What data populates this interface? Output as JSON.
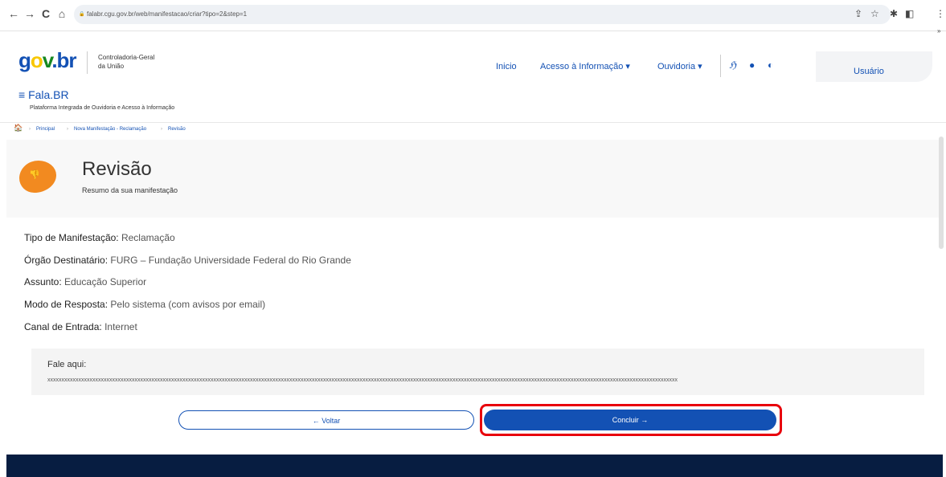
{
  "browser": {
    "url": "falabr.cgu.gov.br/web/manifestacao/criar?tipo=2&step=1",
    "icons": [
      "back-arrow-icon",
      "forward-arrow-icon",
      "reload-icon",
      "home-icon",
      "lock-icon",
      "share-icon",
      "star-icon",
      "extensions-icon",
      "sidepanel-icon",
      "menu-icon"
    ],
    "back": "←",
    "forward": "→",
    "reload": "C",
    "home": "⌂",
    "lock": "🔒",
    "share": "⇪",
    "star": "☆",
    "puzzle": "✱",
    "panel": "◧",
    "more": "⋮",
    "chev": "»"
  },
  "header": {
    "logo": {
      "g": "g",
      "o": "o",
      "v": "v",
      "b": ".br"
    },
    "org_line1": "Controladoria-Geral",
    "org_line2": "da União",
    "menu": [
      "Inicio",
      "Acesso à Informação ▾",
      "Ouvidoria ▾"
    ],
    "a11y_icons": {
      "libras": "ℌ",
      "palette": "●",
      "contrast": "◐"
    },
    "user": "Usuário",
    "app_name": "Fala.BR",
    "app_menu_icon": "≡",
    "app_subtitle": "Plataforma Integrada de Ouvidoria e Acesso à Informação"
  },
  "breadcrumb": {
    "home_icon": "🏠",
    "sep": "›",
    "items": [
      "Principal",
      "Nova Manifestação - Reclamação",
      "Revisão"
    ]
  },
  "page": {
    "title": "Revisão",
    "subtitle": "Resumo da sua manifestação",
    "thumb_icon": "👎"
  },
  "summary": [
    {
      "key": "Tipo de Manifestação:",
      "value": "Reclamação"
    },
    {
      "key": "Órgão Destinatário:",
      "value": "FURG – Fundação Universidade Federal do Rio Grande"
    },
    {
      "key": "Assunto:",
      "value": "Educação Superior"
    },
    {
      "key": "Modo de Resposta:",
      "value": "Pelo sistema (com avisos por email)"
    },
    {
      "key": "Canal de Entrada:",
      "value": "Internet"
    }
  ],
  "fale": {
    "label": "Fale aqui:",
    "text": "xxxxxxxxxxxxxxxxxxxxxxxxxxxxxxxxxxxxxxxxxxxxxxxxxxxxxxxxxxxxxxxxxxxxxxxxxxxxxxxxxxxxxxxxxxxxxxxxxxxxxxxxxxxxxxxxxxxxxxxxxxxxxxxxxxxxxxxxxxxxxxxxxxxxxxxxxxxxxxxxxxxxxxxxxxxxxxxxxxxxxxxxxxxxxxxxxxxxxxxxxxxxxxxxxxxxxxxxxxxxxxxx"
  },
  "buttons": {
    "voltar": "← Voltar",
    "concluir": "Concluir →"
  },
  "colors": {
    "brand_blue": "#1351b4",
    "highlight_red": "#e8000b",
    "footer": "#071d41",
    "accent_orange": "#f28a20"
  }
}
